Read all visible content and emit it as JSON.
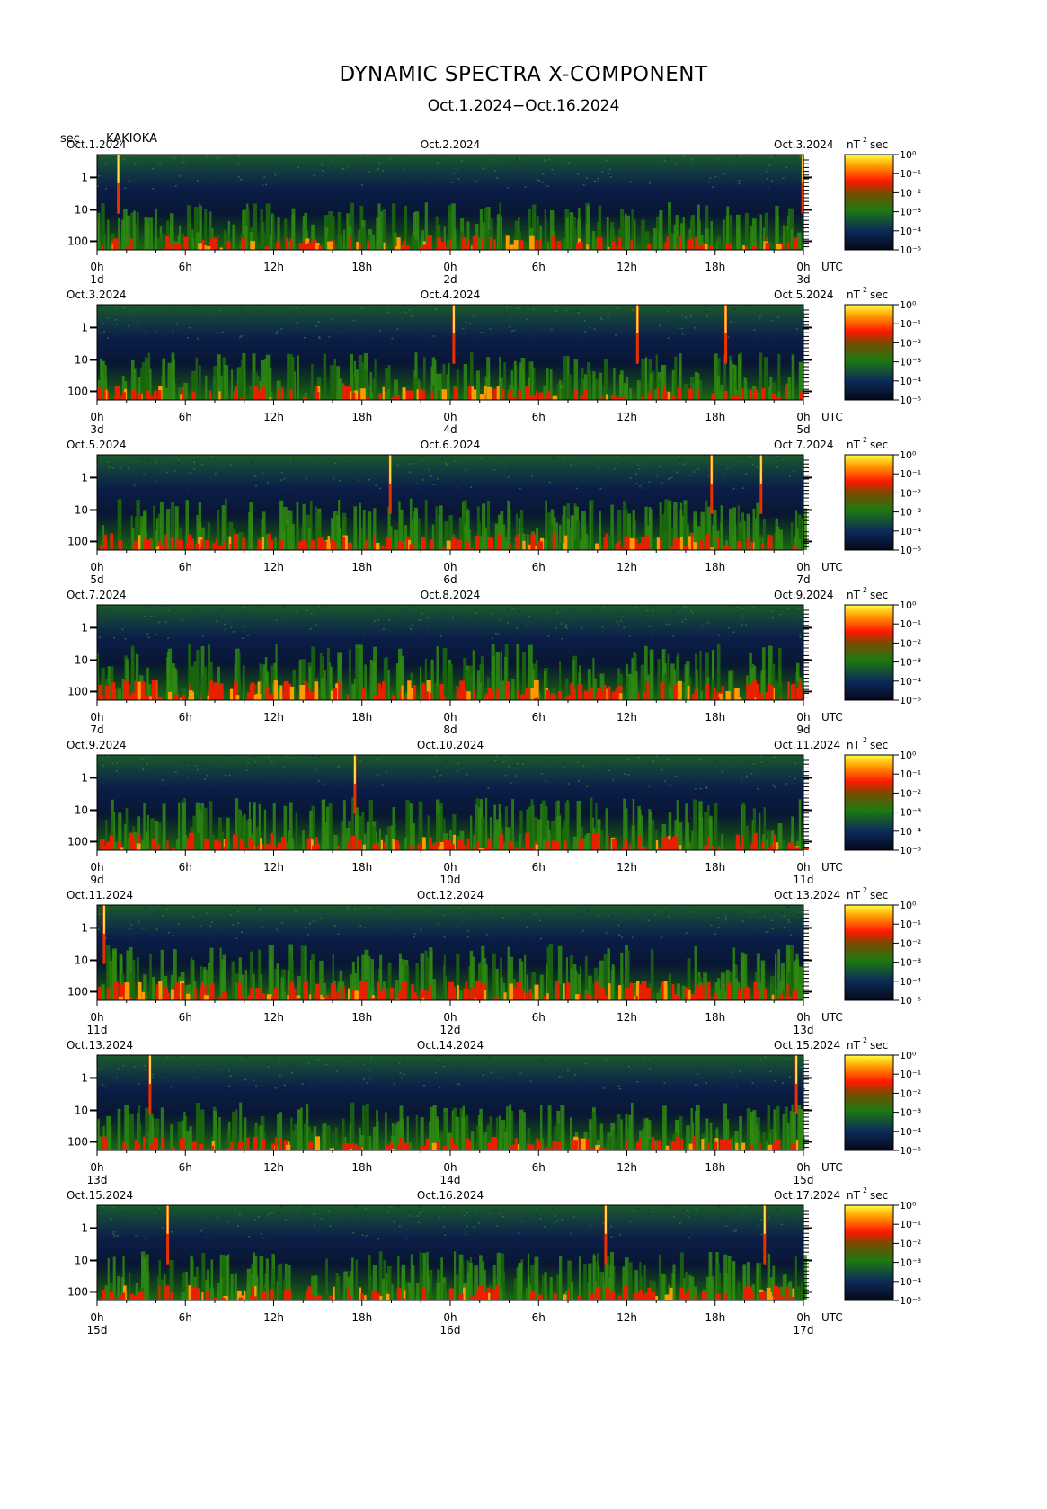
{
  "title": "DYNAMIC SPECTRA X-COMPONENT",
  "subtitle": "Oct.1.2024−Oct.16.2024",
  "y_unit": "sec",
  "station": "KAKIOKA",
  "cb_unit": "nT",
  "cb_unit_sup": "2",
  "cb_unit_tail": "sec",
  "utc": "UTC",
  "colors": {
    "hi": "#ffff50",
    "mid": "#ff2a00",
    "low": "#2a8a00",
    "bg": "#0a1a40",
    "frame": "#000000"
  },
  "chart_data": {
    "type": "heatmap",
    "description_axes": "time (UTC) vs period (sec), log scale",
    "y_ticks": [
      "1",
      "10",
      "100"
    ],
    "x_ticks": [
      "0h",
      "6h",
      "12h",
      "18h",
      "0h",
      "6h",
      "12h",
      "18h",
      "0h"
    ],
    "colorbar_ticks": [
      "10⁰",
      "10⁻¹",
      "10⁻²",
      "10⁻³",
      "10⁻⁴",
      "10⁻⁵"
    ],
    "panels": [
      {
        "left_date": "Oct.1.2024",
        "mid_date": "Oct.2.2024",
        "right_date": "Oct.3.2024",
        "day_labels": [
          "1d",
          "2d",
          "3d"
        ],
        "spikes": [
          0.03,
          0.999
        ],
        "intensity": 0.55
      },
      {
        "left_date": "Oct.3.2024",
        "mid_date": "Oct.4.2024",
        "right_date": "Oct.5.2024",
        "day_labels": [
          "3d",
          "4d",
          "5d"
        ],
        "spikes": [
          0.505,
          0.765,
          0.89
        ],
        "intensity": 0.55
      },
      {
        "left_date": "Oct.5.2024",
        "mid_date": "Oct.6.2024",
        "right_date": "Oct.7.2024",
        "day_labels": [
          "5d",
          "6d",
          "7d"
        ],
        "spikes": [
          0.415,
          0.87,
          0.94
        ],
        "intensity": 0.7
      },
      {
        "left_date": "Oct.7.2024",
        "mid_date": "Oct.8.2024",
        "right_date": "Oct.9.2024",
        "day_labels": [
          "7d",
          "8d",
          "9d"
        ],
        "spikes": [],
        "intensity": 0.9
      },
      {
        "left_date": "Oct.9.2024",
        "mid_date": "Oct.10.2024",
        "right_date": "Oct.11.2024",
        "day_labels": [
          "9d",
          "10d",
          "11d"
        ],
        "spikes": [
          0.365
        ],
        "intensity": 0.75
      },
      {
        "left_date": "Oct.11.2024",
        "mid_date": "Oct.12.2024",
        "right_date": "Oct.13.2024",
        "day_labels": [
          "11d",
          "12d",
          "13d"
        ],
        "spikes": [
          0.01
        ],
        "intensity": 0.9
      },
      {
        "left_date": "Oct.13.2024",
        "mid_date": "Oct.14.2024",
        "right_date": "Oct.15.2024",
        "day_labels": [
          "13d",
          "14d",
          "15d"
        ],
        "spikes": [
          0.075,
          0.99
        ],
        "intensity": 0.55
      },
      {
        "left_date": "Oct.15.2024",
        "mid_date": "Oct.16.2024",
        "right_date": "Oct.17.2024",
        "day_labels": [
          "15d",
          "16d",
          "17d"
        ],
        "spikes": [
          0.1,
          0.72,
          0.945
        ],
        "intensity": 0.6
      }
    ]
  }
}
